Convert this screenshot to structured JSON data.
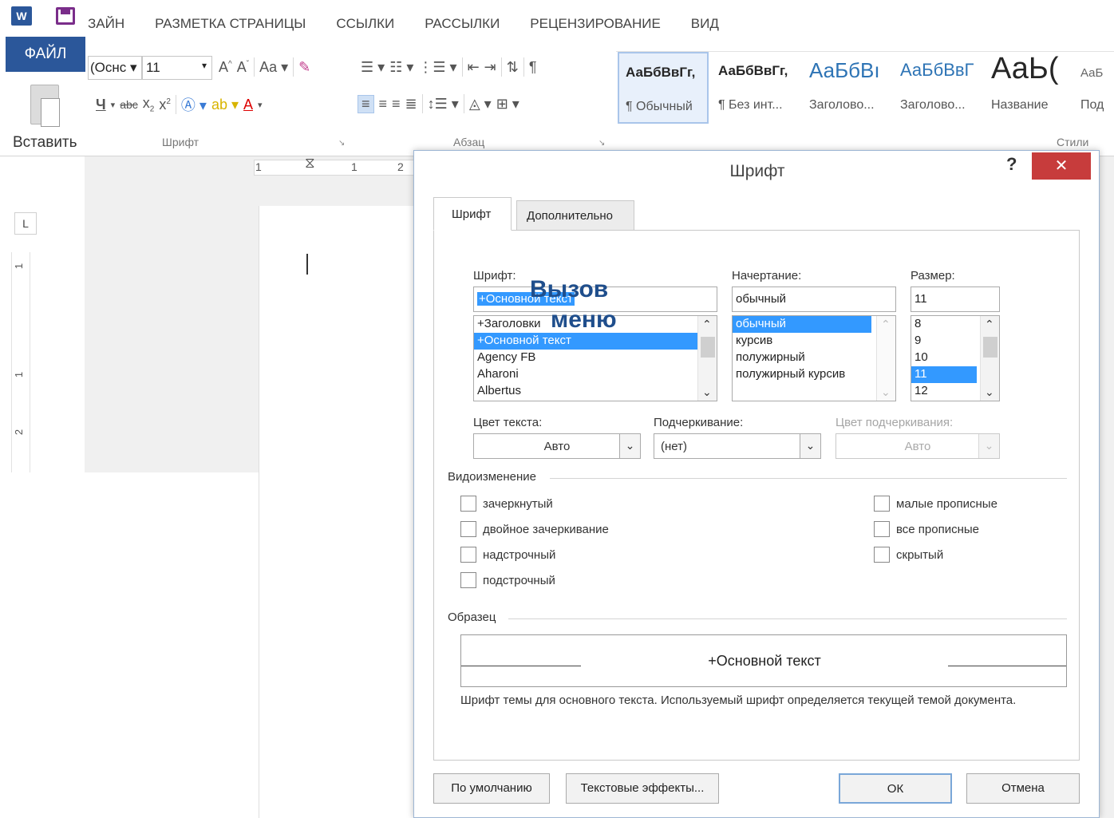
{
  "app": {
    "logo": "W",
    "ribbon_tabs": [
      "ЗАЙН",
      "РАЗМЕТКА СТРАНИЦЫ",
      "ССЫЛКИ",
      "РАССЫЛКИ",
      "РЕЦЕНЗИРОВАНИЕ",
      "ВИД"
    ],
    "file_tab": "ФАЙЛ"
  },
  "ribbon": {
    "paste_label": "Вставить",
    "font_name": "(Оснс",
    "font_size": "11",
    "group_font": "Шрифт",
    "group_paragraph": "Абзац",
    "group_styles": "Стили",
    "styles": [
      {
        "preview": "АаБбВвГг,",
        "name": "¶ Обычный",
        "selected": true
      },
      {
        "preview": "АаБбВвГг,",
        "name": "¶ Без инт..."
      },
      {
        "preview": "АаБбВı",
        "name": "Заголово..."
      },
      {
        "preview": "АаБбВвГ",
        "name": "Заголово..."
      },
      {
        "preview": "АаЬ(",
        "name": "Название"
      },
      {
        "preview": "АаБ",
        "name": "Под"
      }
    ]
  },
  "document": {
    "ruler_ticks": [
      "1",
      "1",
      "2"
    ],
    "vruler_ticks": [
      "1",
      "1",
      "2"
    ],
    "tab_selector": "L"
  },
  "dialog": {
    "title": "Шрифт",
    "help": "?",
    "close": "✕",
    "tabs": [
      "Шрифт",
      "Дополнительно"
    ],
    "font_label": "Шрифт:",
    "font_value": "+Основной текст",
    "font_list": [
      "+Заголовки",
      "+Основной текст",
      "Agency FB",
      "Aharoni",
      "Albertus"
    ],
    "font_list_selected": 1,
    "style_label": "Начертание:",
    "style_value": "обычный",
    "style_list": [
      "обычный",
      "курсив",
      "полужирный",
      "полужирный курсив"
    ],
    "style_list_selected": 0,
    "size_label": "Размер:",
    "size_value": "11",
    "size_list": [
      "8",
      "9",
      "10",
      "11",
      "12"
    ],
    "size_list_selected": 3,
    "color_label": "Цвет текста:",
    "color_value": "Авто",
    "underline_label": "Подчеркивание:",
    "underline_value": "(нет)",
    "underline_color_label": "Цвет подчеркивания:",
    "underline_color_value": "Авто",
    "effects_title": "Видоизменение",
    "effects_left": [
      "зачеркнутый",
      "двойное зачеркивание",
      "надстрочный",
      "подстрочный"
    ],
    "effects_right": [
      "малые прописные",
      "все прописные",
      "скрытый"
    ],
    "sample_title": "Образец",
    "sample_text": "+Основной текст",
    "hint": "Шрифт темы для основного текста. Используемый шрифт определяется текущей темой документа.",
    "buttons": {
      "default": "По умолчанию",
      "effects": "Текстовые эффекты...",
      "ok": "ОК",
      "cancel": "Отмена"
    }
  },
  "overlay": {
    "line1": "Вызов",
    "line2": "меню"
  },
  "colors": {
    "brand": "#2b579a",
    "close": "#c73c3c",
    "selection": "#3399ff",
    "overlay": "#1f4e8c"
  }
}
